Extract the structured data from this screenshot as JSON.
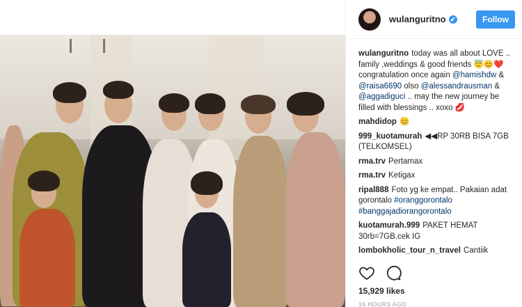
{
  "post": {
    "username": "wulanguritno",
    "verified_mark": "✔",
    "follow_label": "Follow",
    "likes": "15,929 likes",
    "time": "16 HOURS AGO"
  },
  "caption": {
    "user": "wulanguritno",
    "text_1": "today was all about LOVE .. family ,weddings & good friends 😇😊❤️ congratulation once again ",
    "mention_1": "@hamishdw",
    "text_2": " & ",
    "mention_2": "@raisa6690",
    "text_3": " olso ",
    "mention_3": "@alessandrausman",
    "text_4": " & ",
    "mention_4": "@aggadiguci",
    "text_5": " .. may the new journey be filled with blessings .. xoxo 💋"
  },
  "comments": [
    {
      "user": "mahdidop",
      "text": "😊"
    },
    {
      "user": "999_kuotamurah",
      "text": "◀◀RP 30RB BISA 7GB (TELKOMSEL)"
    },
    {
      "user": "rma.trv",
      "text": "Pertamax"
    },
    {
      "user": "rma.trv",
      "text": "Ketigax"
    },
    {
      "user": "ripal888",
      "text": "Foto yg ke empat.. Pakaian adat gorontalo ",
      "tag1": "#oranggorontalo",
      "tag2": "#banggajadiorangorontalo"
    },
    {
      "user": "kuotamurah.999",
      "text": "PAKET HEMAT 30rb=7GB.cek IG"
    },
    {
      "user": "lombokholic_tour_n_travel",
      "text": "Cantiik"
    }
  ],
  "icons": {
    "like": "heart-icon",
    "comment": "comment-icon"
  },
  "colors": {
    "follow_button": "#3897f0",
    "mention": "#003569",
    "text": "#262626"
  }
}
